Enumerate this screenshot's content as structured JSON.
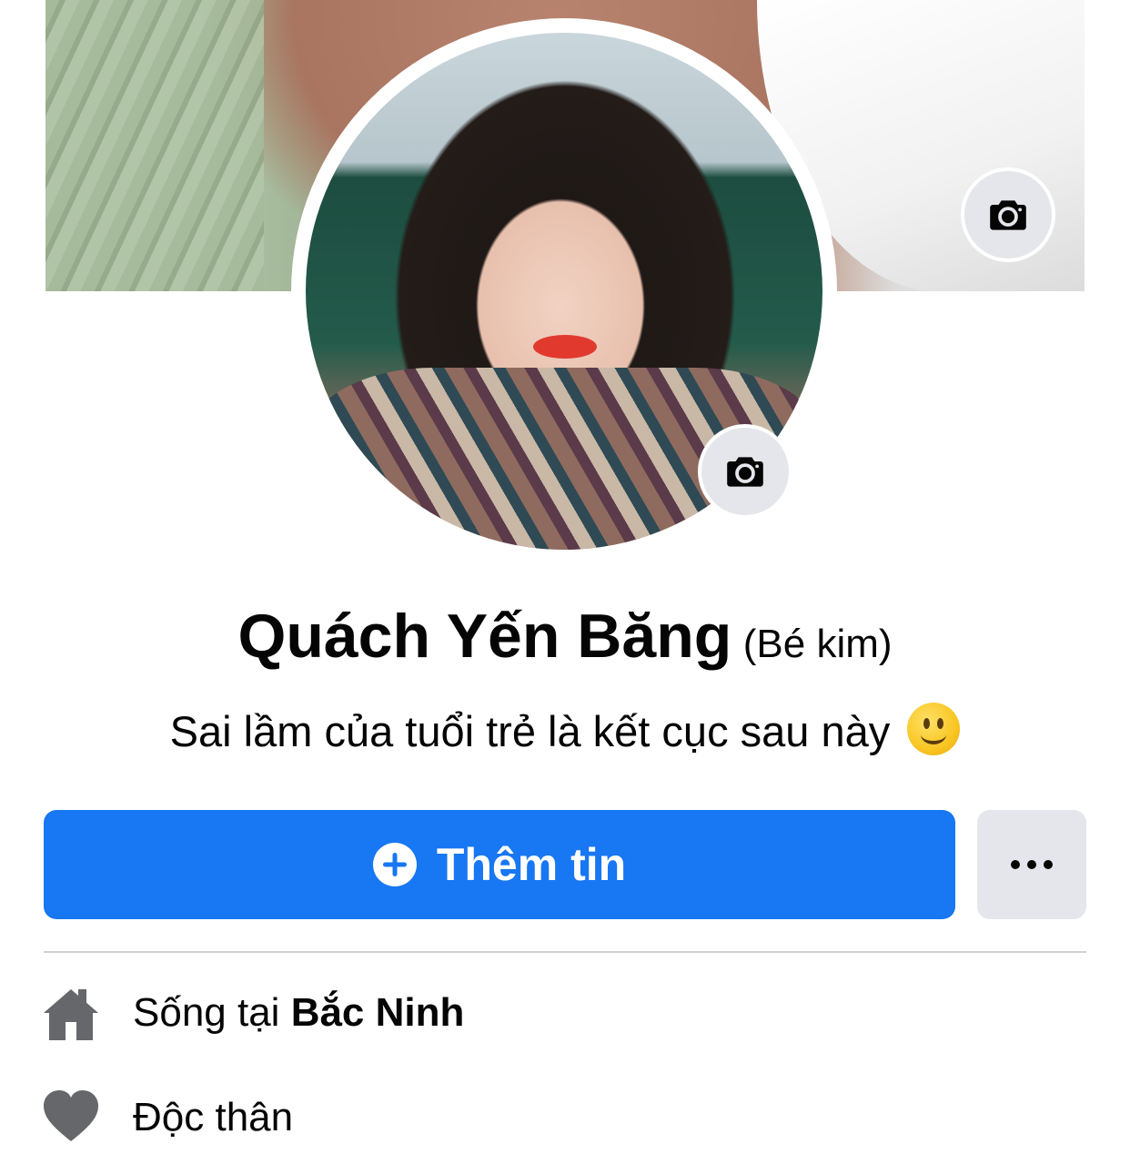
{
  "profile": {
    "name": "Quách Yến Băng",
    "alternate_name": "(Bé kim)",
    "bio": "Sai lầm của tuổi trẻ là kết cục sau này",
    "bio_emoji": "slightly-smiling-face"
  },
  "actions": {
    "primary_label": "Thêm tin",
    "primary_icon": "plus-circle-icon",
    "more_icon": "ellipsis-icon"
  },
  "intro": {
    "items": [
      {
        "icon": "home-icon",
        "prefix": "Sống tại ",
        "value": "Bắc Ninh"
      },
      {
        "icon": "heart-icon",
        "prefix": "Độc thân",
        "value": ""
      }
    ]
  },
  "colors": {
    "primary": "#1877f2",
    "secondary_button": "#e4e6eb",
    "icon_gray": "#65676b",
    "divider": "#ced0d4"
  }
}
